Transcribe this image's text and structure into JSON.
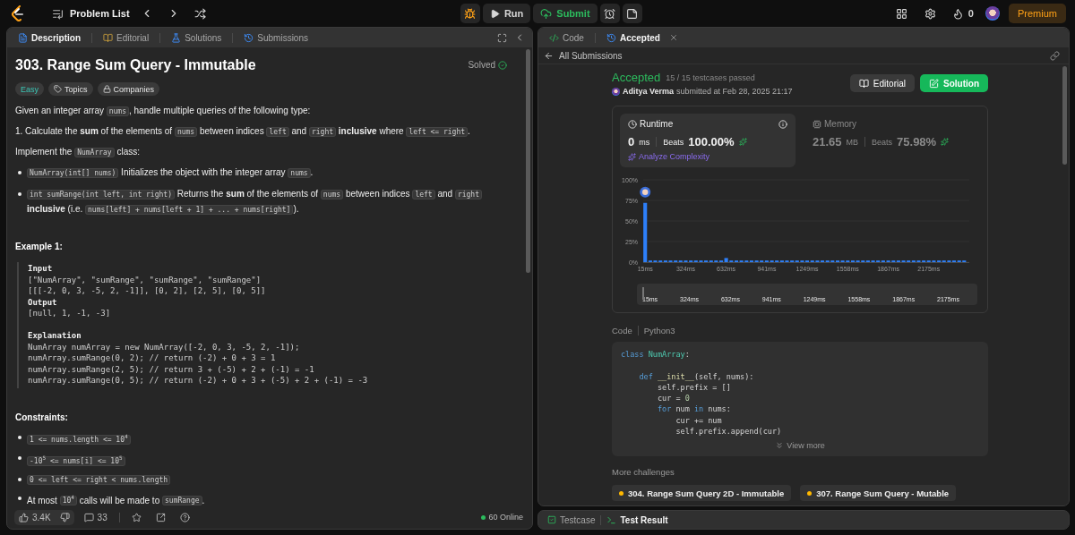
{
  "top_bar": {
    "problem_list": "Problem List",
    "run": "Run",
    "submit": "Submit",
    "streak": "0",
    "premium": "Premium"
  },
  "description": {
    "tabs": [
      {
        "label": "Description",
        "selected": true
      },
      {
        "label": "Editorial",
        "selected": false
      },
      {
        "label": "Solutions",
        "selected": false
      },
      {
        "label": "Submissions",
        "selected": false
      }
    ],
    "title": "303. Range Sum Query - Immutable",
    "status": "Solved",
    "tags": [
      {
        "label": "Easy",
        "kind": "difficulty"
      },
      {
        "label": "Topics",
        "kind": "topics"
      },
      {
        "label": "Companies",
        "kind": "companies"
      }
    ],
    "paragraphs": [
      [
        {
          "kind": "text",
          "text": "Given an integer array "
        },
        {
          "kind": "code",
          "text": "nums"
        },
        {
          "kind": "text",
          "text": ", handle multiple queries of the following type:"
        }
      ],
      [
        {
          "kind": "text",
          "text": "1. Calculate the **sum** of the elements of "
        },
        {
          "kind": "code",
          "text": "nums"
        },
        {
          "kind": "text",
          "text": " between indices "
        },
        {
          "kind": "code",
          "text": "left"
        },
        {
          "kind": "text",
          "text": " and "
        },
        {
          "kind": "code",
          "text": "right"
        },
        {
          "kind": "text",
          "text": " **inclusive** where "
        },
        {
          "kind": "code",
          "text": "left <= right"
        },
        {
          "kind": "text",
          "text": "."
        }
      ],
      [
        {
          "kind": "text",
          "text": "Implement the "
        },
        {
          "kind": "code",
          "text": "NumArray"
        },
        {
          "kind": "text",
          "text": " class:"
        }
      ]
    ],
    "bullets": [
      [
        {
          "kind": "code",
          "text": "NumArray(int[] nums)"
        },
        {
          "kind": "text",
          "text": " Initializes the object with the integer array "
        },
        {
          "kind": "code",
          "text": "nums"
        },
        {
          "kind": "text",
          "text": "."
        }
      ],
      [
        {
          "kind": "code",
          "text": "int sumRange(int left, int right)"
        },
        {
          "kind": "text",
          "text": " Returns the **sum** of the elements of "
        },
        {
          "kind": "code",
          "text": "nums"
        },
        {
          "kind": "text",
          "text": " between indices "
        },
        {
          "kind": "code",
          "text": "left"
        },
        {
          "kind": "text",
          "text": " and "
        },
        {
          "kind": "code",
          "text": "right"
        },
        {
          "kind": "text",
          "text": " **inclusive** (i.e. "
        },
        {
          "kind": "code",
          "text": "nums[left] + nums[left + 1] + ... + nums[right]"
        },
        {
          "kind": "text",
          "text": ")."
        }
      ]
    ],
    "example_heading": "Example 1:",
    "example_lines": [
      {
        "kind": "label",
        "text": "Input"
      },
      {
        "kind": "code",
        "text": "[\"NumArray\", \"sumRange\", \"sumRange\", \"sumRange\"]"
      },
      {
        "kind": "code",
        "text": "[[[-2, 0, 3, -5, 2, -1]], [0, 2], [2, 5], [0, 5]]"
      },
      {
        "kind": "label",
        "text": "Output"
      },
      {
        "kind": "code",
        "text": "[null, 1, -1, -3]"
      },
      {
        "kind": "blank"
      },
      {
        "kind": "label",
        "text": "Explanation"
      },
      {
        "kind": "code",
        "text": "NumArray numArray = new NumArray([-2, 0, 3, -5, 2, -1]);"
      },
      {
        "kind": "code",
        "text": "numArray.sumRange(0, 2); // return (-2) + 0 + 3 = 1"
      },
      {
        "kind": "code",
        "text": "numArray.sumRange(2, 5); // return 3 + (-5) + 2 + (-1) = -1"
      },
      {
        "kind": "code",
        "text": "numArray.sumRange(0, 5); // return (-2) + 0 + 3 + (-5) + 2 + (-1) = -3"
      }
    ],
    "constraints_heading": "Constraints:",
    "constraints": [
      [
        {
          "kind": "code",
          "text": "1 <= nums.length <= 10$^{4}$"
        }
      ],
      [
        {
          "kind": "code",
          "text": "-10$^{5}$ <= nums[i] <= 10$^{5}$"
        }
      ],
      [
        {
          "kind": "code",
          "text": "0 <= left <= right < nums.length"
        }
      ],
      [
        {
          "kind": "text",
          "text": "At most "
        },
        {
          "kind": "code",
          "text": "10$^{4}$"
        },
        {
          "kind": "text",
          "text": " calls will be made to "
        },
        {
          "kind": "code",
          "text": "sumRange"
        },
        {
          "kind": "text",
          "text": "."
        }
      ]
    ],
    "footer": {
      "likes": "3.4K",
      "comments": "33",
      "online": "60 Online"
    }
  },
  "submission": {
    "tabs": [
      {
        "label": "Code",
        "selected": false
      },
      {
        "label": "Accepted",
        "selected": true
      }
    ],
    "back": "All Submissions",
    "status": "Accepted",
    "testcases": "15 / 15 testcases passed",
    "author": "Aditya Verma",
    "submitted": "submitted at Feb 28, 2025 21:17",
    "buttons": [
      {
        "label": "Editorial",
        "kind": "secondary"
      },
      {
        "label": "Solution",
        "kind": "primary"
      }
    ],
    "metrics": [
      {
        "title": "Runtime",
        "value": "0",
        "unit": "ms",
        "beats_label": "Beats",
        "beats": "100.00%",
        "selected": true,
        "link": "Analyze Complexity"
      },
      {
        "title": "Memory",
        "value": "21.65",
        "unit": "MB",
        "beats_label": "Beats",
        "beats": "75.98%",
        "selected": false
      }
    ],
    "chart_data": {
      "type": "bar",
      "ylim": [
        0,
        100
      ],
      "xlim": [
        0,
        2484
      ],
      "yticks": [
        {
          "value": 0,
          "label": "0%"
        },
        {
          "value": 25,
          "label": "25%"
        },
        {
          "value": 50,
          "label": "50%"
        },
        {
          "value": 75,
          "label": "75%"
        },
        {
          "value": 100,
          "label": "100%"
        }
      ],
      "xticks": [
        {
          "value": 15,
          "label": "15ms"
        },
        {
          "value": 324,
          "label": "324ms"
        },
        {
          "value": 632,
          "label": "632ms"
        },
        {
          "value": 941,
          "label": "941ms"
        },
        {
          "value": 1249,
          "label": "1249ms"
        },
        {
          "value": 1558,
          "label": "1558ms"
        },
        {
          "value": 1867,
          "label": "1867ms"
        },
        {
          "value": 2175,
          "label": "2175ms"
        }
      ],
      "x": [
        15,
        54,
        92,
        131,
        170,
        208,
        247,
        285,
        324,
        363,
        401,
        440,
        478,
        517,
        555,
        594,
        632,
        671,
        710,
        748,
        787,
        825,
        864,
        902,
        941,
        980,
        1018,
        1057,
        1095,
        1134,
        1172,
        1211,
        1249,
        1288,
        1327,
        1365,
        1404,
        1442,
        1481,
        1519,
        1558,
        1597,
        1635,
        1674,
        1712,
        1751,
        1789,
        1828,
        1867,
        1906,
        1944,
        1983,
        2021,
        2060,
        2098,
        2137,
        2175,
        2214,
        2253,
        2291,
        2330,
        2368,
        2407,
        2445
      ],
      "values": [
        72,
        2,
        2,
        2,
        2,
        2,
        2,
        2,
        2,
        2,
        2,
        2,
        2,
        2,
        2,
        2,
        5,
        2,
        2,
        2,
        2,
        2,
        2,
        2,
        2,
        2,
        2,
        2,
        2,
        2,
        2,
        2,
        2,
        2,
        2,
        2,
        2,
        2,
        2,
        2,
        2,
        2,
        2,
        2,
        2,
        2,
        2,
        2,
        2,
        2,
        2,
        2,
        2,
        2,
        2,
        2,
        2,
        2,
        2,
        2,
        2,
        2,
        2,
        2
      ]
    },
    "brush_labels": [
      "15ms",
      "324ms",
      "632ms",
      "941ms",
      "1249ms",
      "1558ms",
      "1867ms",
      "2175ms"
    ],
    "code_label": "Code",
    "language": "Python3",
    "code_lines": [
      {
        "kind": "code",
        "tokens": [
          {
            "kind": "keyword",
            "text": "class "
          },
          {
            "kind": "class",
            "text": "NumArray"
          },
          {
            "kind": "plain",
            "text": ":"
          }
        ]
      },
      {
        "kind": "blank"
      },
      {
        "kind": "code",
        "tokens": [
          {
            "kind": "keyword",
            "text": "    def "
          },
          {
            "kind": "func",
            "text": "__init__"
          },
          {
            "kind": "plain",
            "text": "(self, nums):"
          }
        ]
      },
      {
        "kind": "code",
        "tokens": [
          {
            "kind": "plain",
            "text": "        self.prefix = []"
          }
        ]
      },
      {
        "kind": "code",
        "tokens": [
          {
            "kind": "plain",
            "text": "        cur = "
          },
          {
            "kind": "number",
            "text": "0"
          }
        ]
      },
      {
        "kind": "code",
        "tokens": [
          {
            "kind": "keyword",
            "text": "        for"
          },
          {
            "kind": "plain",
            "text": " num "
          },
          {
            "kind": "keyword",
            "text": "in"
          },
          {
            "kind": "plain",
            "text": " nums:"
          }
        ]
      },
      {
        "kind": "code",
        "tokens": [
          {
            "kind": "plain",
            "text": "            cur += num"
          }
        ]
      },
      {
        "kind": "code",
        "tokens": [
          {
            "kind": "plain",
            "text": "            self.prefix.append(cur)"
          }
        ]
      }
    ],
    "view_more": "View more",
    "more_heading": "More challenges",
    "challenges": [
      "304. Range Sum Query 2D - Immutable",
      "307. Range Sum Query - Mutable"
    ]
  },
  "bottom_tabs": [
    {
      "label": "Testcase",
      "selected": false
    },
    {
      "label": "Test Result",
      "selected": true
    }
  ]
}
